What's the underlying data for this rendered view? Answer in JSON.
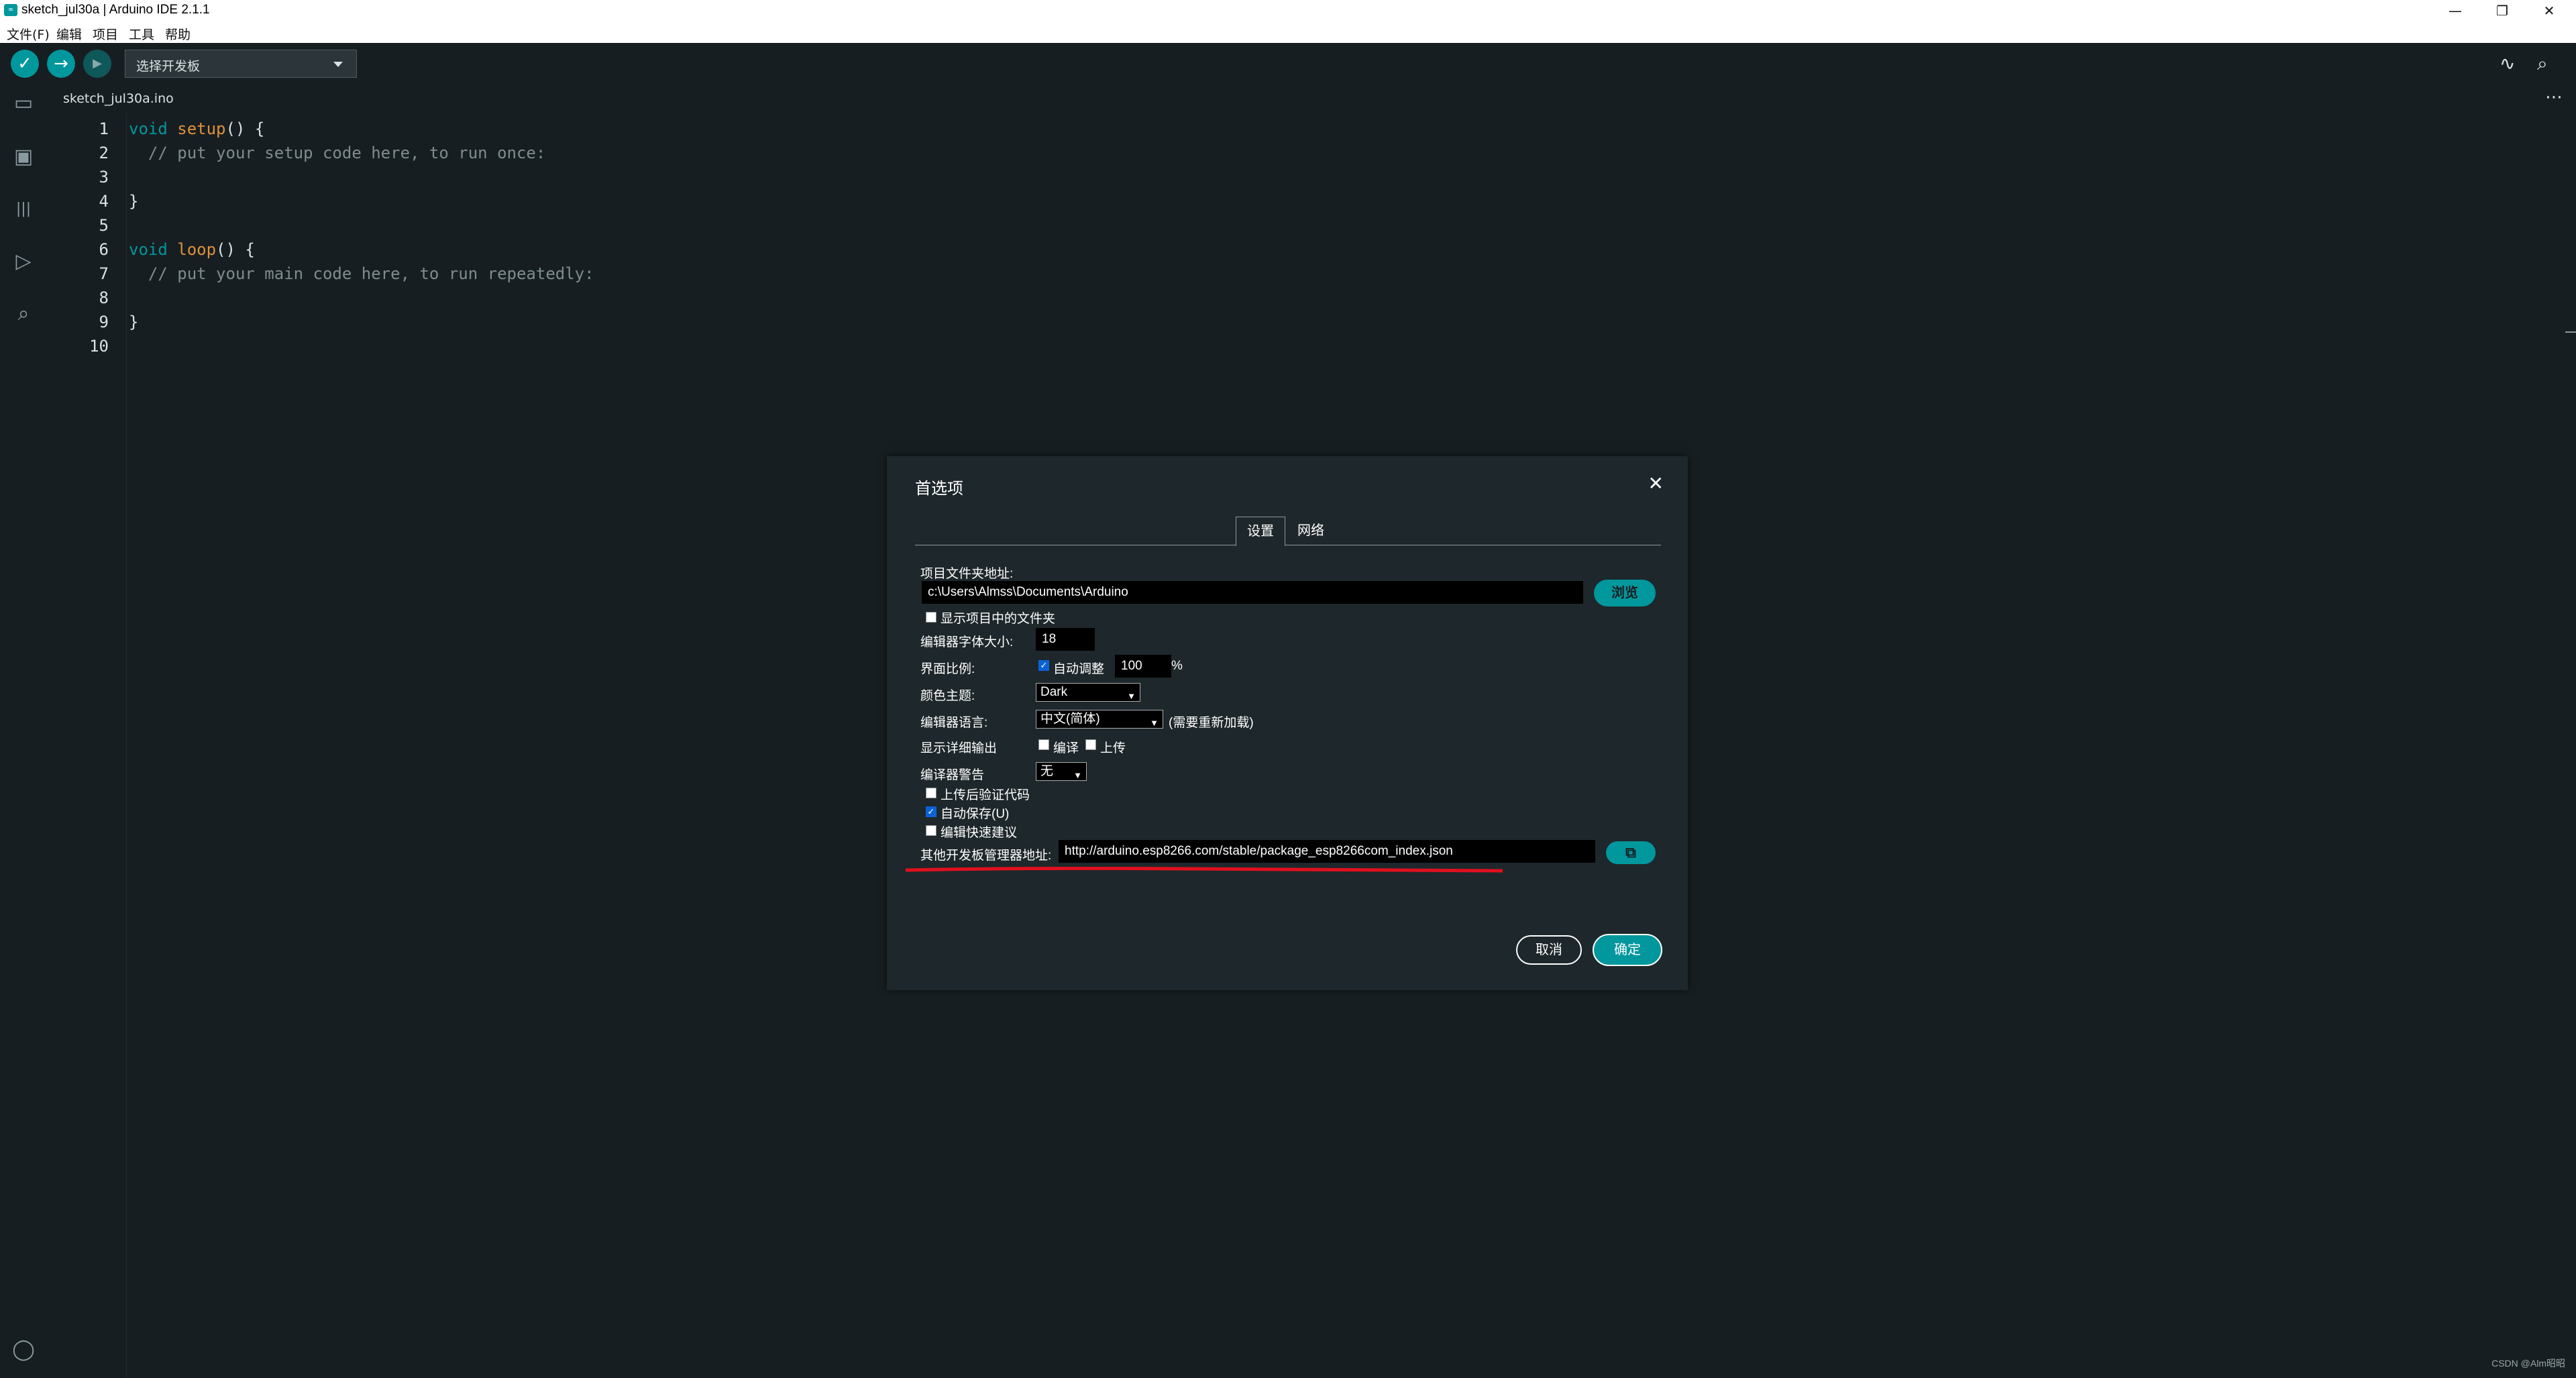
{
  "window": {
    "title": "sketch_jul30a | Arduino IDE 2.1.1",
    "app_icon_text": "∞",
    "minimize": "—",
    "maximize": "❐",
    "close": "✕"
  },
  "menu": [
    "文件(F)",
    "编辑",
    "项目",
    "工具",
    "帮助"
  ],
  "toolbar": {
    "verify_icon": "✓",
    "upload_icon": "→",
    "debug_icon": "▶",
    "board_select_label": "选择开发板",
    "serial_plotter_icon": "∿",
    "serial_monitor_icon": "⌕"
  },
  "sidebar": {
    "sketchbook_icon": "▭",
    "boards_icon": "▣",
    "library_icon": "|||",
    "debug_icon": "▷",
    "search_icon": "⌕",
    "account_icon": "◯"
  },
  "editor": {
    "tab_name": "sketch_jul30a.ino",
    "more_icon": "⋯",
    "line_numbers": [
      "1",
      "2",
      "3",
      "4",
      "5",
      "6",
      "7",
      "8",
      "9",
      "10"
    ],
    "lines": [
      {
        "kw": "void",
        "fn": "setup",
        "rest": "() {"
      },
      {
        "comment": "  // put your setup code here, to run once:"
      },
      {
        "plain": ""
      },
      {
        "plain": "}"
      },
      {
        "plain": ""
      },
      {
        "kw": "void",
        "fn": "loop",
        "rest": "() {"
      },
      {
        "comment": "  // put your main code here, to run repeatedly:"
      },
      {
        "plain": ""
      },
      {
        "plain": "}"
      },
      {
        "plain": ""
      }
    ]
  },
  "dialog": {
    "title": "首选项",
    "close_icon": "✕",
    "tabs": [
      "设置",
      "网络"
    ],
    "sketchbook_location_label": "项目文件夹地址:",
    "sketchbook_location_value": "c:\\Users\\Almss\\Documents\\Arduino",
    "browse_button": "浏览",
    "show_files_label": "显示项目中的文件夹",
    "font_size_label": "编辑器字体大小:",
    "font_size_value": "18",
    "scale_label": "界面比例:",
    "auto_adjust_label": "自动调整",
    "scale_value": "100",
    "scale_unit": "%",
    "theme_label": "颜色主题:",
    "theme_value": "Dark",
    "language_label": "编辑器语言:",
    "language_value": "中文(简体)",
    "language_note": "(需要重新加载)",
    "verbose_label": "显示详细输出",
    "verbose_compile_label": "编译",
    "verbose_upload_label": "上传",
    "warnings_label": "编译器警告",
    "warnings_value": "无",
    "verify_after_upload_label": "上传后验证代码",
    "auto_save_label": "自动保存(U)",
    "quick_suggestions_label": "编辑快速建议",
    "board_urls_label": "其他开发板管理器地址:",
    "board_urls_value": "http://arduino.esp8266.com/stable/package_esp8266com_index.json",
    "board_urls_icon": "⧉",
    "cancel_button": "取消",
    "ok_button": "确定",
    "checkbox_states": {
      "show_files": false,
      "auto_adjust": true,
      "verbose_compile": false,
      "verbose_upload": false,
      "verify_after_upload": false,
      "auto_save": true,
      "quick_suggestions": false
    }
  },
  "watermark": "CSDN @Alm昭昭",
  "colors": {
    "accent": "#00979d",
    "background": "#171e21",
    "dialog_bg": "#1e272b",
    "annotation_red": "#e0101e"
  }
}
